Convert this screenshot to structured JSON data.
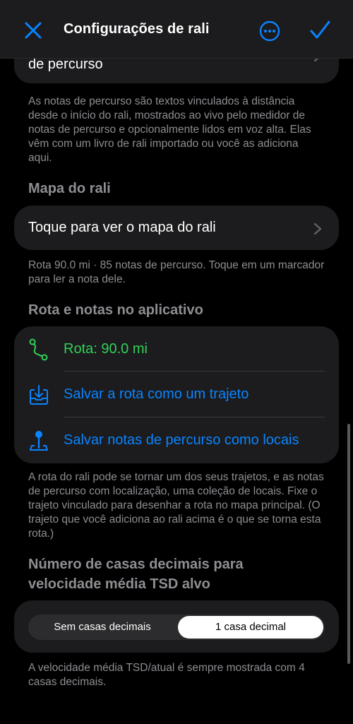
{
  "header": {
    "title": "Configurações de rali"
  },
  "partial_row": {
    "label": "de percurso"
  },
  "notes_description": "As notas de percurso são textos vinculados à distância desde o início do rali, mostrados ao vivo pelo medidor de notas de percurso e opcionalmente lidos em voz alta. Elas vêm com um livro de rali importado ou você as adiciona aqui.",
  "map_section": {
    "heading": "Mapa do rali",
    "row_label": "Toque para ver o mapa do rali",
    "footer": "Rota 90.0 mi · 85 notas de percurso. Toque em um marcador para ler a nota dele."
  },
  "route_section": {
    "heading": "Rota e notas no aplicativo",
    "route_label": "Rota: 90.0 mi",
    "save_route_label": "Salvar a rota como um trajeto",
    "save_notes_label": "Salvar notas de percurso como locais",
    "footer": "A rota do rali pode se tornar um dos seus trajetos, e as notas de percurso com localização, uma coleção de locais. Fixe o trajeto vinculado para desenhar a rota no mapa principal. (O trajeto que você adiciona ao rali acima é o que se torna esta rota.)"
  },
  "decimals_section": {
    "heading_line1": "Número de casas decimais para",
    "heading_line2": "velocidade média TSD alvo",
    "options": [
      "Sem casas decimais",
      "1 casa decimal"
    ],
    "selected": "1 casa decimal",
    "footer": "A velocidade média TSD/atual é sempre mostrada com 4 casas decimais."
  },
  "colors": {
    "accent": "#0a84ff",
    "route_green": "#30d158",
    "background": "#000000",
    "card": "#1c1c1e",
    "secondary_text": "#8e8e93"
  },
  "icons": {
    "close": "xmark-icon",
    "more": "ellipsis-circle-icon",
    "done": "checkmark-icon",
    "route": "route-icon",
    "save_route": "tray-download-icon",
    "save_notes": "map-pin-icon",
    "chevron": "chevron-right-icon"
  }
}
